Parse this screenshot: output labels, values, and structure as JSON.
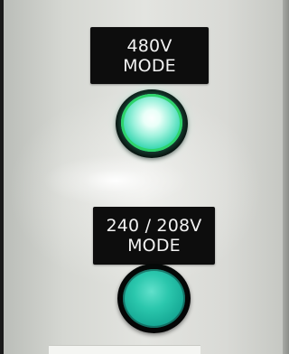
{
  "panel": {
    "color": "#d8d9d6"
  },
  "labels": {
    "label_480": {
      "line1": "480V",
      "line2": "MODE"
    },
    "label_240": {
      "line1": "240 / 208V",
      "line2": "MODE"
    }
  },
  "indicators": {
    "indicator_480": {
      "state": "lit",
      "color": "#39d7b1",
      "ring_color": "#2ed36b"
    },
    "indicator_240": {
      "state": "unlit",
      "color": "#16a995"
    }
  }
}
